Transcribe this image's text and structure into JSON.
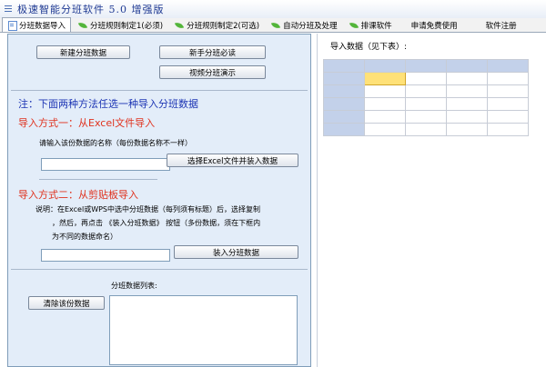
{
  "window": {
    "title": "极速智能分班软件 5.0 增强版"
  },
  "tabs": [
    {
      "label": "分班数据导入",
      "icon": "document-icon",
      "active": true
    },
    {
      "label": "分班规则制定1(必须)",
      "icon": "leaf-icon"
    },
    {
      "label": "分班规则制定2(可选)",
      "icon": "leaf-icon"
    },
    {
      "label": "自动分班及处理",
      "icon": "leaf-icon"
    },
    {
      "label": "排课软件",
      "icon": "leaf-icon"
    },
    {
      "label": "申请免费使用"
    },
    {
      "label": "软件注册"
    }
  ],
  "left": {
    "new_data_button": "新建分班数据",
    "beginner_button": "新手分班必读",
    "video_button": "视频分班演示",
    "note": "注：下面两种方法任选一种导入分班数据",
    "method1_title": "导入方式一：从Excel文件导入",
    "method1_prompt": "请输入该份数据的名称（每份数据名称不一样）",
    "method1_input_value": "",
    "method1_button": "选择Excel文件并装入数据",
    "method2_title": "导入方式二：从剪贴板导入",
    "method2_desc_line1": "说明：在Excel或WPS中选中分班数据（每列须有标题）后，选择复制",
    "method2_desc_line2": "，然后，再点击 《装入分班数据》 按钮（多份数据，须在下框内",
    "method2_desc_line3": "为不同的数据命名）",
    "method2_input_value": "",
    "method2_button": "装入分班数据",
    "list_label": "分班数据列表:",
    "clear_button": "清除该份数据"
  },
  "right": {
    "import_label": "导入数据（见下表）:"
  },
  "colors": {
    "accent_blue": "#1d35b4",
    "accent_red": "#e0321e",
    "panel_bg": "#e3edf9",
    "selected_cell": "#ffe178"
  }
}
